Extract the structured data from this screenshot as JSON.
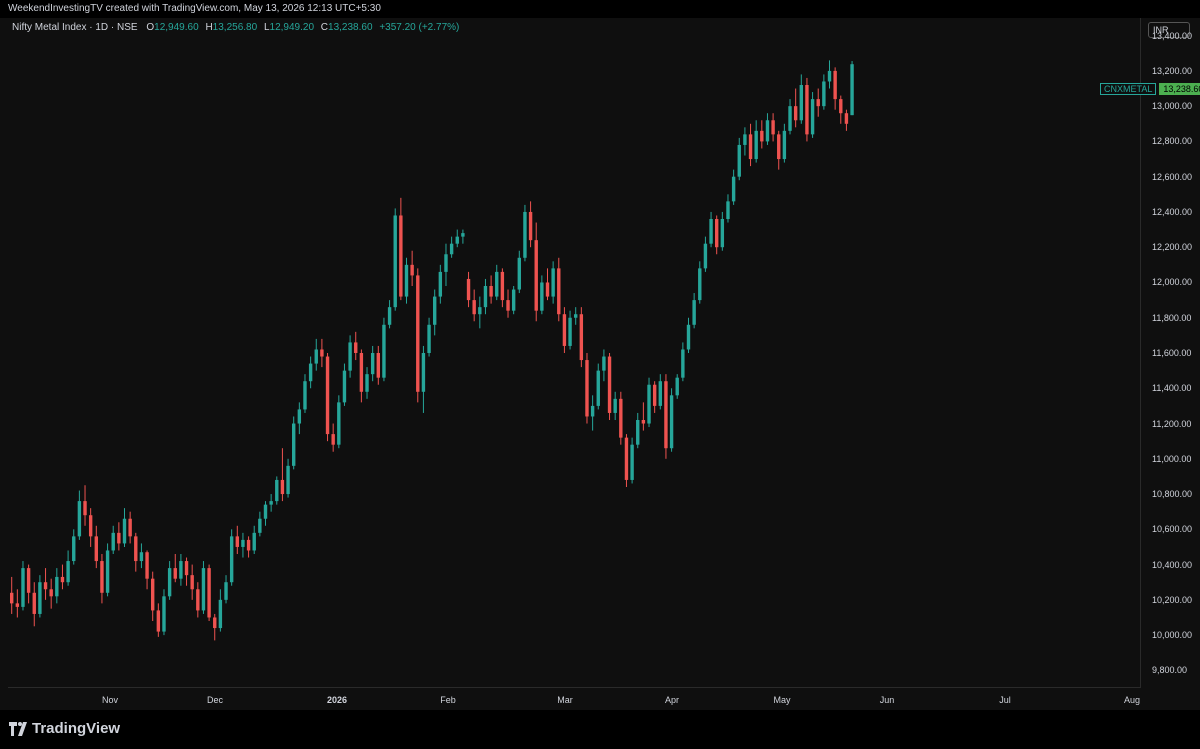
{
  "header": {
    "credit": "WeekendInvestingTV created with TradingView.com, May 13, 2026 12:13 UTC+5:30"
  },
  "legend": {
    "symbol": "Nifty Metal Index · 1D · NSE",
    "o_label": "O",
    "o_value": "12,949.60",
    "h_label": "H",
    "h_value": "13,256.80",
    "l_label": "L",
    "l_value": "12,949.20",
    "c_label": "C",
    "c_value": "13,238.60",
    "change": "+357.20 (+2.77%)"
  },
  "currency": "INR",
  "last_price": {
    "symbol": "CNXMETAL",
    "price": "13,238.60"
  },
  "footer": {
    "brand": "TradingView"
  },
  "colors": {
    "up": "#26a69a",
    "down": "#ef5350",
    "background": "#0f0f0f"
  },
  "chart_data": {
    "type": "candlestick",
    "ylim": [
      9700,
      13500
    ],
    "y_ticks": [
      "13,400.00",
      "13,200.00",
      "13,000.00",
      "12,800.00",
      "12,600.00",
      "12,400.00",
      "12,200.00",
      "12,000.00",
      "11,800.00",
      "11,600.00",
      "11,400.00",
      "11,200.00",
      "11,000.00",
      "10,800.00",
      "10,600.00",
      "10,400.00",
      "10,200.00",
      "10,000.00",
      "9,800.00"
    ],
    "x_ticks": [
      {
        "label": "Nov",
        "bold": false
      },
      {
        "label": "Dec",
        "bold": false
      },
      {
        "label": "2026",
        "bold": true
      },
      {
        "label": "Feb",
        "bold": false
      },
      {
        "label": "Mar",
        "bold": false
      },
      {
        "label": "Apr",
        "bold": false
      },
      {
        "label": "May",
        "bold": false
      },
      {
        "label": "Jun",
        "bold": false
      },
      {
        "label": "Jul",
        "bold": false
      },
      {
        "label": "Aug",
        "bold": false
      }
    ],
    "ohlc": [
      [
        10240,
        10330,
        10120,
        10180
      ],
      [
        10180,
        10260,
        10100,
        10160
      ],
      [
        10160,
        10420,
        10140,
        10380
      ],
      [
        10380,
        10400,
        10180,
        10240
      ],
      [
        10240,
        10300,
        10050,
        10120
      ],
      [
        10120,
        10340,
        10100,
        10300
      ],
      [
        10300,
        10380,
        10200,
        10260
      ],
      [
        10260,
        10320,
        10150,
        10220
      ],
      [
        10220,
        10380,
        10180,
        10330
      ],
      [
        10330,
        10400,
        10260,
        10300
      ],
      [
        10300,
        10480,
        10280,
        10420
      ],
      [
        10420,
        10600,
        10400,
        10560
      ],
      [
        10560,
        10820,
        10540,
        10760
      ],
      [
        10760,
        10850,
        10620,
        10680
      ],
      [
        10680,
        10720,
        10500,
        10560
      ],
      [
        10560,
        10620,
        10380,
        10420
      ],
      [
        10420,
        10460,
        10180,
        10240
      ],
      [
        10240,
        10520,
        10220,
        10480
      ],
      [
        10480,
        10620,
        10460,
        10580
      ],
      [
        10580,
        10640,
        10480,
        10520
      ],
      [
        10520,
        10720,
        10500,
        10660
      ],
      [
        10660,
        10700,
        10520,
        10560
      ],
      [
        10560,
        10580,
        10360,
        10420
      ],
      [
        10420,
        10520,
        10380,
        10470
      ],
      [
        10470,
        10480,
        10260,
        10320
      ],
      [
        10320,
        10360,
        10080,
        10140
      ],
      [
        10140,
        10180,
        9990,
        10020
      ],
      [
        10020,
        10260,
        10000,
        10220
      ],
      [
        10220,
        10420,
        10200,
        10380
      ],
      [
        10380,
        10460,
        10300,
        10320
      ],
      [
        10320,
        10460,
        10280,
        10420
      ],
      [
        10420,
        10440,
        10280,
        10340
      ],
      [
        10340,
        10400,
        10200,
        10260
      ],
      [
        10260,
        10300,
        10100,
        10140
      ],
      [
        10140,
        10420,
        10120,
        10380
      ],
      [
        10380,
        10400,
        10080,
        10100
      ],
      [
        10100,
        10120,
        9970,
        10040
      ],
      [
        10040,
        10260,
        10020,
        10200
      ],
      [
        10200,
        10340,
        10180,
        10300
      ],
      [
        10300,
        10600,
        10280,
        10560
      ],
      [
        10560,
        10620,
        10460,
        10500
      ],
      [
        10500,
        10580,
        10440,
        10540
      ],
      [
        10540,
        10560,
        10440,
        10480
      ],
      [
        10480,
        10620,
        10460,
        10580
      ],
      [
        10580,
        10700,
        10560,
        10660
      ],
      [
        10660,
        10760,
        10620,
        10740
      ],
      [
        10740,
        10800,
        10700,
        10760
      ],
      [
        10760,
        10900,
        10740,
        10880
      ],
      [
        10880,
        11060,
        10760,
        10800
      ],
      [
        10800,
        11000,
        10780,
        10960
      ],
      [
        10960,
        11240,
        10940,
        11200
      ],
      [
        11200,
        11320,
        11140,
        11280
      ],
      [
        11280,
        11480,
        11260,
        11440
      ],
      [
        11440,
        11580,
        11400,
        11540
      ],
      [
        11540,
        11680,
        11500,
        11620
      ],
      [
        11620,
        11680,
        11520,
        11580
      ],
      [
        11580,
        11600,
        11100,
        11140
      ],
      [
        11140,
        11200,
        11040,
        11080
      ],
      [
        11080,
        11360,
        11060,
        11320
      ],
      [
        11320,
        11540,
        11300,
        11500
      ],
      [
        11500,
        11700,
        11460,
        11660
      ],
      [
        11660,
        11720,
        11560,
        11600
      ],
      [
        11600,
        11620,
        11320,
        11380
      ],
      [
        11380,
        11520,
        11340,
        11480
      ],
      [
        11480,
        11640,
        11440,
        11600
      ],
      [
        11600,
        11640,
        11420,
        11460
      ],
      [
        11460,
        11800,
        11440,
        11760
      ],
      [
        11760,
        11900,
        11740,
        11860
      ],
      [
        11860,
        12420,
        11840,
        12380
      ],
      [
        12380,
        12480,
        11900,
        11920
      ],
      [
        11920,
        12140,
        11880,
        12100
      ],
      [
        12100,
        12180,
        11980,
        12040
      ],
      [
        12040,
        12080,
        11320,
        11380
      ],
      [
        11380,
        11640,
        11260,
        11600
      ],
      [
        11600,
        11800,
        11580,
        11760
      ],
      [
        11760,
        11960,
        11700,
        11920
      ],
      [
        11920,
        12100,
        11880,
        12060
      ],
      [
        12060,
        12220,
        11980,
        12160
      ],
      [
        12160,
        12260,
        12140,
        12220
      ],
      [
        12220,
        12300,
        12200,
        12260
      ],
      [
        12260,
        12300,
        12220,
        12280
      ],
      [
        12020,
        12060,
        11860,
        11900
      ],
      [
        11900,
        11960,
        11780,
        11820
      ],
      [
        11820,
        11920,
        11740,
        11860
      ],
      [
        11860,
        12020,
        11820,
        11980
      ],
      [
        11980,
        12040,
        11880,
        11920
      ],
      [
        11920,
        12100,
        11900,
        12060
      ],
      [
        12060,
        12080,
        11860,
        11900
      ],
      [
        11900,
        11960,
        11800,
        11840
      ],
      [
        11840,
        11980,
        11820,
        11960
      ],
      [
        11960,
        12180,
        11940,
        12140
      ],
      [
        12140,
        12440,
        12120,
        12400
      ],
      [
        12400,
        12460,
        12200,
        12240
      ],
      [
        12240,
        12340,
        11780,
        11840
      ],
      [
        11840,
        12040,
        11820,
        12000
      ],
      [
        12000,
        12080,
        11900,
        11920
      ],
      [
        11920,
        12120,
        11880,
        12080
      ],
      [
        12080,
        12140,
        11780,
        11820
      ],
      [
        11820,
        11860,
        11600,
        11640
      ],
      [
        11640,
        11840,
        11620,
        11800
      ],
      [
        11800,
        11860,
        11760,
        11820
      ],
      [
        11820,
        11860,
        11520,
        11560
      ],
      [
        11560,
        11600,
        11200,
        11240
      ],
      [
        11240,
        11360,
        11160,
        11300
      ],
      [
        11300,
        11540,
        11280,
        11500
      ],
      [
        11500,
        11620,
        11440,
        11580
      ],
      [
        11580,
        11600,
        11220,
        11260
      ],
      [
        11260,
        11380,
        11220,
        11340
      ],
      [
        11340,
        11380,
        11080,
        11120
      ],
      [
        11120,
        11140,
        10840,
        10880
      ],
      [
        10880,
        11120,
        10860,
        11080
      ],
      [
        11080,
        11260,
        11060,
        11220
      ],
      [
        11220,
        11320,
        11160,
        11200
      ],
      [
        11200,
        11460,
        11180,
        11420
      ],
      [
        11420,
        11440,
        11260,
        11300
      ],
      [
        11300,
        11480,
        11280,
        11440
      ],
      [
        11440,
        11480,
        11000,
        11060
      ],
      [
        11060,
        11400,
        11040,
        11360
      ],
      [
        11360,
        11480,
        11340,
        11460
      ],
      [
        11460,
        11660,
        11440,
        11620
      ],
      [
        11620,
        11800,
        11600,
        11760
      ],
      [
        11760,
        11940,
        11740,
        11900
      ],
      [
        11900,
        12120,
        11880,
        12080
      ],
      [
        12080,
        12260,
        12060,
        12220
      ],
      [
        12220,
        12400,
        12200,
        12360
      ],
      [
        12360,
        12380,
        12160,
        12200
      ],
      [
        12200,
        12400,
        12180,
        12360
      ],
      [
        12360,
        12500,
        12340,
        12460
      ],
      [
        12460,
        12640,
        12440,
        12600
      ],
      [
        12600,
        12820,
        12580,
        12780
      ],
      [
        12780,
        12880,
        12720,
        12840
      ],
      [
        12840,
        12900,
        12660,
        12700
      ],
      [
        12700,
        12920,
        12680,
        12860
      ],
      [
        12860,
        12920,
        12760,
        12800
      ],
      [
        12800,
        12960,
        12780,
        12920
      ],
      [
        12920,
        12960,
        12800,
        12840
      ],
      [
        12840,
        12860,
        12640,
        12700
      ],
      [
        12700,
        12900,
        12680,
        12860
      ],
      [
        12860,
        13040,
        12840,
        13000
      ],
      [
        13000,
        13100,
        12880,
        12920
      ],
      [
        12920,
        13180,
        12900,
        13120
      ],
      [
        13120,
        13160,
        12800,
        12840
      ],
      [
        12840,
        13080,
        12820,
        13040
      ],
      [
        13040,
        13100,
        12940,
        13000
      ],
      [
        13000,
        13180,
        12980,
        13140
      ],
      [
        13140,
        13260,
        13100,
        13200
      ],
      [
        13200,
        13220,
        12980,
        13040
      ],
      [
        13040,
        13060,
        12900,
        12960
      ],
      [
        12960,
        12980,
        12860,
        12900
      ],
      [
        12949,
        13256,
        12949,
        13238
      ]
    ]
  }
}
